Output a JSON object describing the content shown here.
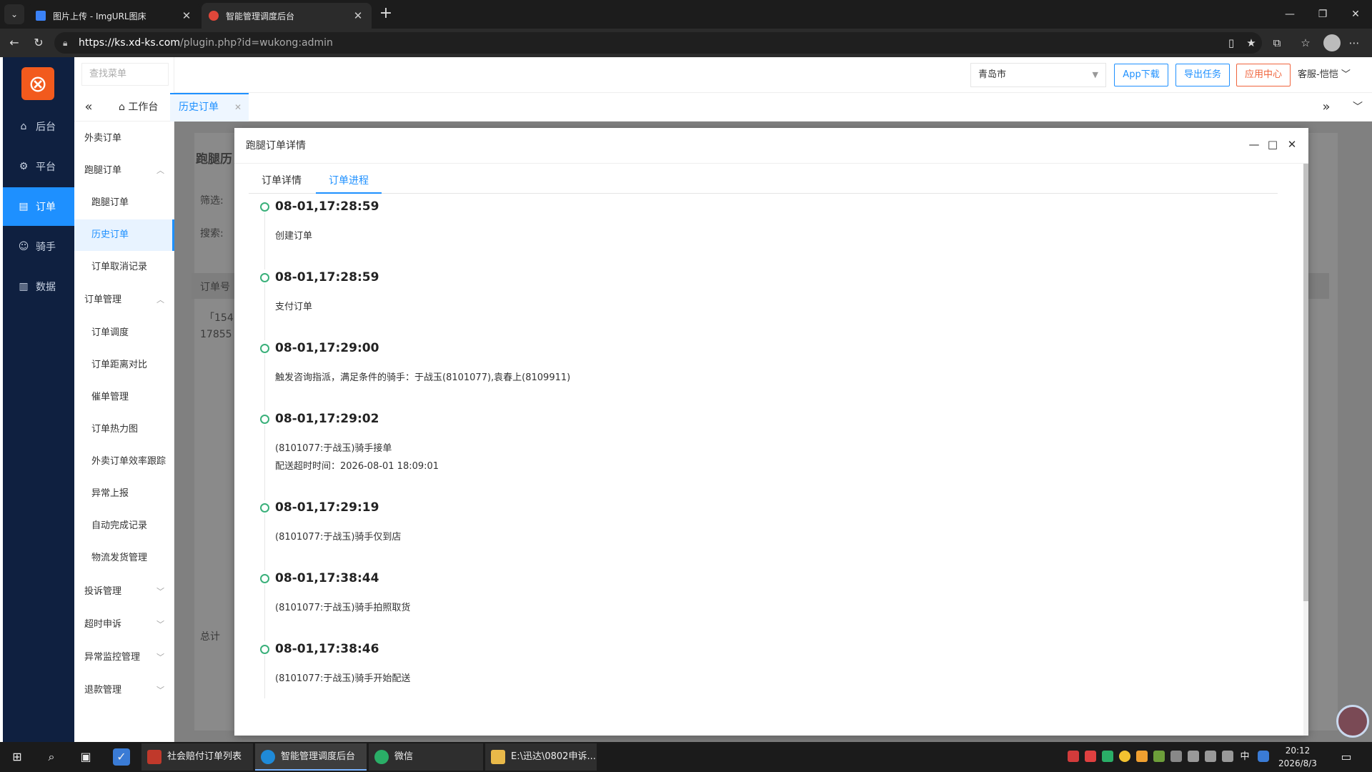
{
  "browser": {
    "tabs": [
      {
        "title": "图片上传 - ImgURL图床",
        "close": "✕"
      },
      {
        "title": "智能管理调度后台",
        "close": "✕"
      }
    ],
    "new_tab": "+",
    "url_host": "https://ks.xd-ks.com",
    "url_path": "/plugin.php?id=wukong:admin"
  },
  "leftbar": {
    "items": [
      {
        "label": "后台",
        "icon": "home-icon"
      },
      {
        "label": "平台",
        "icon": "gear-icon"
      },
      {
        "label": "订单",
        "icon": "document-icon"
      },
      {
        "label": "骑手",
        "icon": "user-icon"
      },
      {
        "label": "数据",
        "icon": "bar-chart-icon"
      }
    ]
  },
  "sidemenu": {
    "search_placeholder": "查找菜单",
    "items": [
      {
        "label": "外卖订单"
      },
      {
        "label": "跑腿订单"
      },
      {
        "label": "跑腿订单"
      },
      {
        "label": "历史订单"
      },
      {
        "label": "订单取消记录"
      },
      {
        "label": "订单管理"
      },
      {
        "label": "订单调度"
      },
      {
        "label": "订单距离对比"
      },
      {
        "label": "催单管理"
      },
      {
        "label": "订单热力图"
      },
      {
        "label": "外卖订单效率跟踪"
      },
      {
        "label": "异常上报"
      },
      {
        "label": "自动完成记录"
      },
      {
        "label": "物流发货管理"
      },
      {
        "label": "投诉管理"
      },
      {
        "label": "超时申诉"
      },
      {
        "label": "异常监控管理"
      },
      {
        "label": "退款管理"
      }
    ]
  },
  "topbar": {
    "city": "青岛市",
    "app_download": "App下载",
    "export_task": "导出任务",
    "app_center": "应用中心",
    "user": "客服-恺恺"
  },
  "page_tabs": {
    "home": "工作台",
    "history": "历史订单"
  },
  "background": {
    "page_title": "跑腿历",
    "filter_label": "筛选:",
    "search_label": "搜索:",
    "col_order": "订单号",
    "row_a": "「154",
    "row_b": "17855",
    "total": "总计"
  },
  "modal": {
    "title": "跑腿订单详情",
    "tabs": {
      "detail": "订单详情",
      "progress": "订单进程"
    },
    "timeline": [
      {
        "time": "08-01,17:28:59",
        "lines": [
          "创建订单"
        ]
      },
      {
        "time": "08-01,17:28:59",
        "lines": [
          "支付订单"
        ]
      },
      {
        "time": "08-01,17:29:00",
        "lines": [
          "触发咨询指派，满足条件的骑手：于战玉(8101077),袁春上(8109911)"
        ]
      },
      {
        "time": "08-01,17:29:02",
        "lines": [
          "(8101077:于战玉)骑手接单",
          "配送超时时间：2026-08-01 18:09:01"
        ]
      },
      {
        "time": "08-01,17:29:19",
        "lines": [
          "(8101077:于战玉)骑手仅到店"
        ]
      },
      {
        "time": "08-01,17:38:44",
        "lines": [
          "(8101077:于战玉)骑手拍照取货"
        ]
      },
      {
        "time": "08-01,17:38:46",
        "lines": [
          "(8101077:于战玉)骑手开始配送"
        ]
      }
    ]
  },
  "taskbar": {
    "apps": [
      {
        "label": "社会赔付订单列表0..."
      },
      {
        "label": "智能管理调度后台 ..."
      },
      {
        "label": "微信"
      },
      {
        "label": "E:\\迅达\\0802申诉..."
      }
    ],
    "ime": "中",
    "time": "20:12",
    "date": "2026/8/3"
  }
}
